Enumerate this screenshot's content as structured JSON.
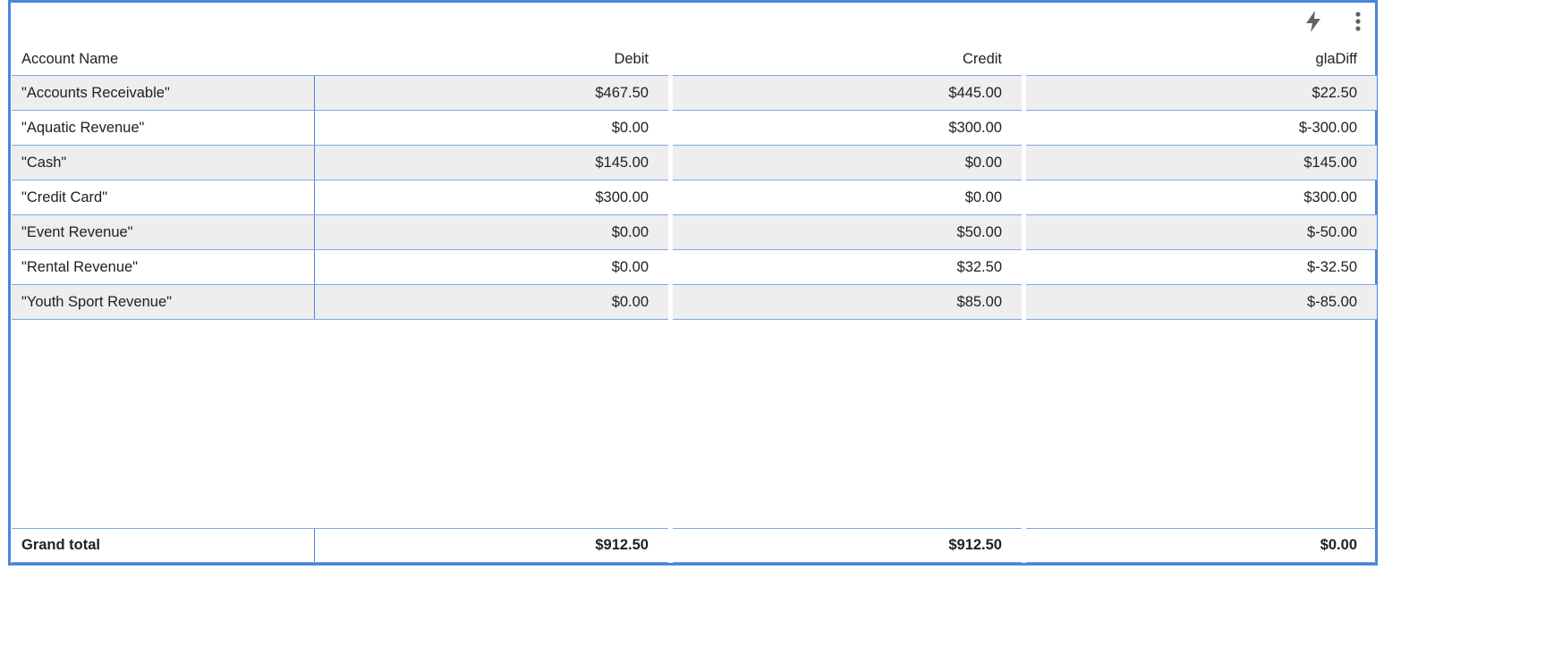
{
  "toolbar": {
    "icons": [
      "lightning-icon",
      "more-vert-icon"
    ]
  },
  "table": {
    "columns": [
      "Account Name",
      "Debit",
      "Credit",
      "glaDiff"
    ],
    "rows": [
      [
        "\"Accounts Receivable\"",
        "$467.50",
        "$445.00",
        "$22.50"
      ],
      [
        "\"Aquatic Revenue\"",
        "$0.00",
        "$300.00",
        "$-300.00"
      ],
      [
        "\"Cash\"",
        "$145.00",
        "$0.00",
        "$145.00"
      ],
      [
        "\"Credit Card\"",
        "$300.00",
        "$0.00",
        "$300.00"
      ],
      [
        "\"Event Revenue\"",
        "$0.00",
        "$50.00",
        "$-50.00"
      ],
      [
        "\"Rental Revenue\"",
        "$0.00",
        "$32.50",
        "$-32.50"
      ],
      [
        "\"Youth Sport Revenue\"",
        "$0.00",
        "$85.00",
        "$-85.00"
      ]
    ],
    "total": [
      "Grand total",
      "$912.50",
      "$912.50",
      "$0.00"
    ]
  },
  "colors": {
    "frame_border": "#4a86d8",
    "row_alt": "#eeeeee",
    "separator": "#7fa7e0"
  }
}
